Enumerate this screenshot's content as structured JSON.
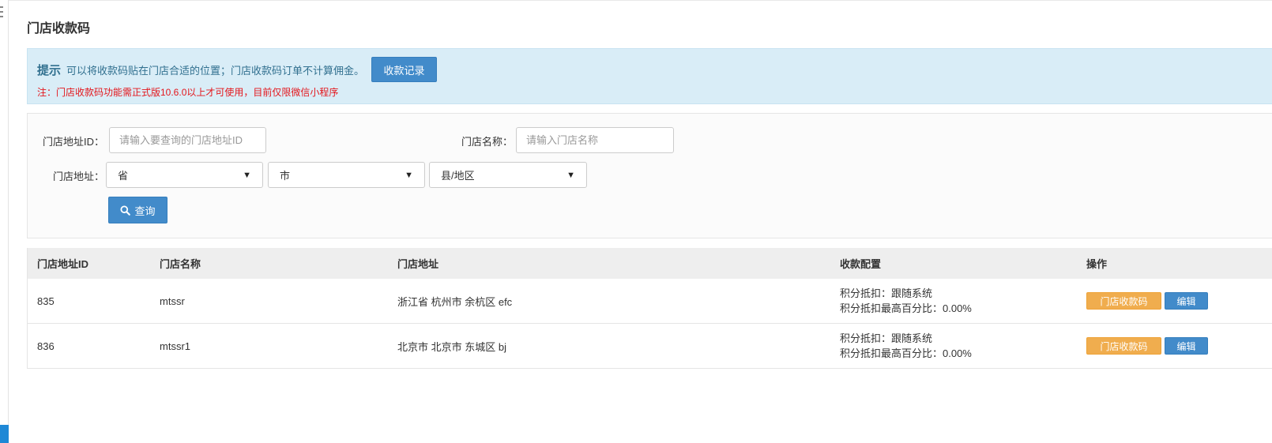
{
  "page": {
    "title": "门店收款码"
  },
  "alert": {
    "label": "提示",
    "text": "可以将收款码贴在门店合适的位置；门店收款码订单不计算佣金。",
    "records_button": "收款记录",
    "note": "注：门店收款码功能需正式版10.6.0以上才可使用，目前仅限微信小程序"
  },
  "filter": {
    "id_label": "门店地址ID：",
    "id_placeholder": "请输入要查询的门店地址ID",
    "name_label": "门店名称：",
    "name_placeholder": "请输入门店名称",
    "address_label": "门店地址：",
    "province": "省",
    "city": "市",
    "district": "县/地区",
    "search_button": "查询"
  },
  "table": {
    "headers": [
      "门店地址ID",
      "门店名称",
      "门店地址",
      "收款配置",
      "操作"
    ],
    "rows": [
      {
        "id": "835",
        "name": "mtssr",
        "address": "浙江省 杭州市 余杭区 efc",
        "config_line1": "积分抵扣：跟随系统",
        "config_line2": "积分抵扣最高百分比：0.00%",
        "qr_button": "门店收款码",
        "edit_button": "编辑"
      },
      {
        "id": "836",
        "name": "mtssr1",
        "address": "北京市 北京市 东城区 bj",
        "config_line1": "积分抵扣：跟随系统",
        "config_line2": "积分抵扣最高百分比：0.00%",
        "qr_button": "门店收款码",
        "edit_button": "编辑"
      }
    ]
  },
  "colors": {
    "primary": "#428bca",
    "warning": "#f0ad4e",
    "alert_bg": "#d9edf7",
    "note_red": "#e4161c",
    "accent_blue": "#1e88d6"
  }
}
